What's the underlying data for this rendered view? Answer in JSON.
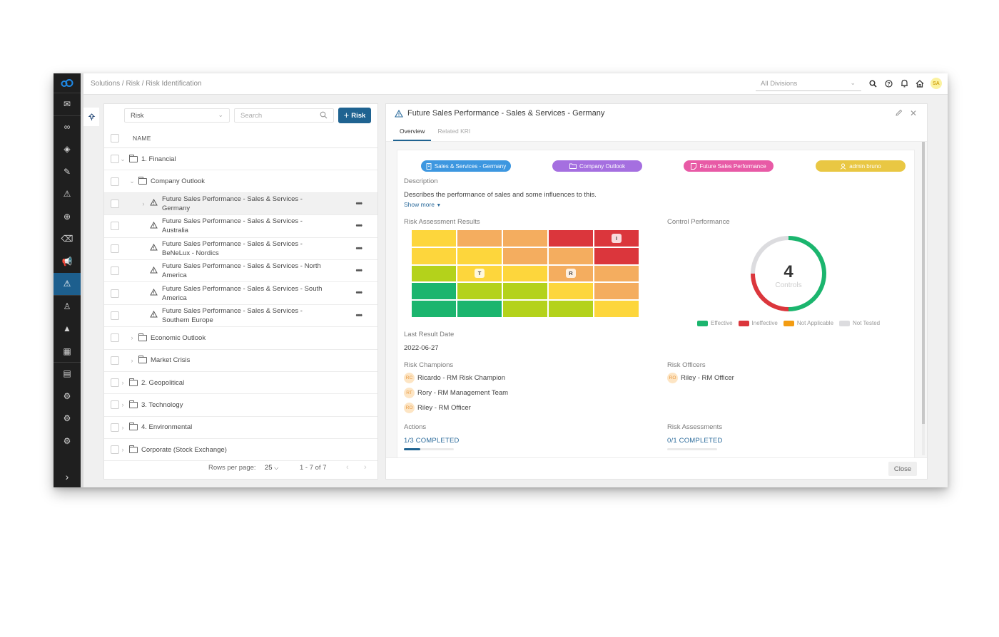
{
  "topbar": {
    "breadcrumb": "Solutions / Risk / Risk Identification",
    "division_select": "All Divisions",
    "user_initials": "SA",
    "icons": [
      "search-icon",
      "help-icon",
      "bell-icon",
      "home-icon"
    ]
  },
  "rail": {
    "items": [
      {
        "icon": "mail-icon",
        "glyph": "✉"
      },
      {
        "icon": "infinity-icon",
        "glyph": "∞"
      },
      {
        "icon": "diamond-icon",
        "glyph": "◈"
      },
      {
        "icon": "pencil-icon",
        "glyph": "✎"
      },
      {
        "icon": "warning-icon",
        "glyph": "⚠"
      },
      {
        "icon": "globe-icon",
        "glyph": "⊕"
      },
      {
        "icon": "eraser-icon",
        "glyph": "⌫"
      },
      {
        "icon": "megaphone-icon",
        "glyph": "📢"
      },
      {
        "icon": "risk-icon",
        "glyph": "⚠",
        "active": true
      },
      {
        "icon": "person-icon",
        "glyph": "♙"
      },
      {
        "icon": "alert-filled-icon",
        "glyph": "▲"
      },
      {
        "icon": "buildings-icon",
        "glyph": "▦"
      },
      {
        "icon": "building-icon",
        "glyph": "▤"
      },
      {
        "icon": "settings-icon",
        "glyph": "⚙"
      },
      {
        "icon": "settings-icon-2",
        "glyph": "⚙"
      },
      {
        "icon": "settings-icon-3",
        "glyph": "⚙"
      }
    ],
    "expand_glyph": "›"
  },
  "list": {
    "type_select": "Risk",
    "search_placeholder": "Search",
    "add_button": "Risk",
    "column_name": "NAME",
    "rows": [
      {
        "label": "1. Financial",
        "kind": "folder",
        "level": 0,
        "twisty": "⌄"
      },
      {
        "label": "Company Outlook",
        "kind": "folder",
        "level": 1,
        "twisty": "⌄"
      },
      {
        "label": "Future Sales Performance - Sales & Services - Germany",
        "kind": "risk",
        "level": 2,
        "twisty": "›",
        "selected": true,
        "menu": true
      },
      {
        "label": "Future Sales Performance - Sales & Services - Australia",
        "kind": "risk",
        "level": 2,
        "twisty": "",
        "menu": true
      },
      {
        "label": "Future Sales Performance - Sales & Services - BeNeLux - Nordics",
        "kind": "risk",
        "level": 2,
        "twisty": "",
        "menu": true
      },
      {
        "label": "Future Sales Performance - Sales & Services - North America",
        "kind": "risk",
        "level": 2,
        "twisty": "",
        "menu": true
      },
      {
        "label": "Future Sales Performance - Sales & Services - South America",
        "kind": "risk",
        "level": 2,
        "twisty": "",
        "menu": true
      },
      {
        "label": "Future Sales Performance - Sales & Services - Southern Europe",
        "kind": "risk",
        "level": 2,
        "twisty": "",
        "menu": true
      },
      {
        "label": "Economic Outlook",
        "kind": "folder",
        "level": 1,
        "twisty": "›"
      },
      {
        "label": "Market Crisis",
        "kind": "folder",
        "level": 1,
        "twisty": "›"
      },
      {
        "label": "2. Geopolitical",
        "kind": "folder",
        "level": 0,
        "twisty": "›"
      },
      {
        "label": "3. Technology",
        "kind": "folder",
        "level": 0,
        "twisty": "›"
      },
      {
        "label": "4. Environmental",
        "kind": "folder",
        "level": 0,
        "twisty": "›"
      },
      {
        "label": "Corporate (Stock Exchange)",
        "kind": "folder",
        "level": 0,
        "twisty": "›"
      }
    ],
    "footer": {
      "rows_per_page_label": "Rows per page:",
      "rows_per_page_value": "25",
      "range": "1 - 7 of 7"
    }
  },
  "detail": {
    "title": "Future Sales Performance - Sales & Services - Germany",
    "tabs": [
      {
        "label": "Overview",
        "active": true
      },
      {
        "label": "Related KRI",
        "active": false
      }
    ],
    "chips": [
      {
        "label": "Sales & Services - Germany",
        "icon": "building-icon",
        "color": "#3d97e0"
      },
      {
        "label": "Company Outlook",
        "icon": "folder-icon",
        "color": "#a56fe0"
      },
      {
        "label": "Future Sales Performance",
        "icon": "document-icon",
        "color": "#e85aa6"
      },
      {
        "label": "admin bruno",
        "icon": "user-icon",
        "color": "#e9c743"
      }
    ],
    "description_label": "Description",
    "description": "Describes the performance of sales and some influences to this.",
    "show_more": "Show more",
    "risk_assessment_label": "Risk Assessment Results",
    "control_performance_label": "Control Performance",
    "last_result_date_label": "Last Result Date",
    "last_result_date": "2022-06-27",
    "risk_champions_label": "Risk Champions",
    "risk_champions": [
      {
        "initials": "RC",
        "name": "Ricardo - RM Risk Champion"
      },
      {
        "initials": "RT",
        "name": "Rory - RM Management Team"
      },
      {
        "initials": "RO",
        "name": "Riley - RM Officer"
      }
    ],
    "risk_officers_label": "Risk Officers",
    "risk_officers": [
      {
        "initials": "RO",
        "name": "Riley - RM Officer"
      }
    ],
    "actions_label": "Actions",
    "actions_progress": "1/3 COMPLETED",
    "actions_fraction": 0.333,
    "assessments_label": "Risk Assessments",
    "assessments_progress": "0/1 COMPLETED",
    "assessments_fraction": 0,
    "close_button": "Close"
  },
  "chart_data": [
    {
      "type": "heatmap",
      "title": "Risk Assessment Results",
      "rows": 5,
      "cols": 5,
      "palette": {
        "G": "#1bb56e",
        "L": "#b4d21b",
        "Y": "#fdd63c",
        "O": "#f4ad5f",
        "R": "#db363c"
      },
      "cells": [
        [
          "Y",
          "O",
          "O",
          "R",
          "R"
        ],
        [
          "Y",
          "Y",
          "O",
          "O",
          "R"
        ],
        [
          "L",
          "Y",
          "Y",
          "O",
          "O"
        ],
        [
          "G",
          "L",
          "L",
          "Y",
          "O"
        ],
        [
          "G",
          "G",
          "L",
          "L",
          "Y"
        ]
      ],
      "markers": [
        {
          "label": "I",
          "row": 0,
          "col": 4
        },
        {
          "label": "T",
          "row": 2,
          "col": 1
        },
        {
          "label": "R",
          "row": 2,
          "col": 3
        }
      ]
    },
    {
      "type": "pie",
      "title": "Control Performance",
      "center_value": "4",
      "center_label": "Controls",
      "series": [
        {
          "name": "Effective",
          "value": 2,
          "color": "#1bb56e"
        },
        {
          "name": "Ineffective",
          "value": 1,
          "color": "#db363c"
        },
        {
          "name": "Not Applicable",
          "value": 0,
          "color": "#f39c12"
        },
        {
          "name": "Not Tested",
          "value": 1,
          "color": "#dcdcdf"
        }
      ],
      "legend_position": "bottom"
    }
  ]
}
